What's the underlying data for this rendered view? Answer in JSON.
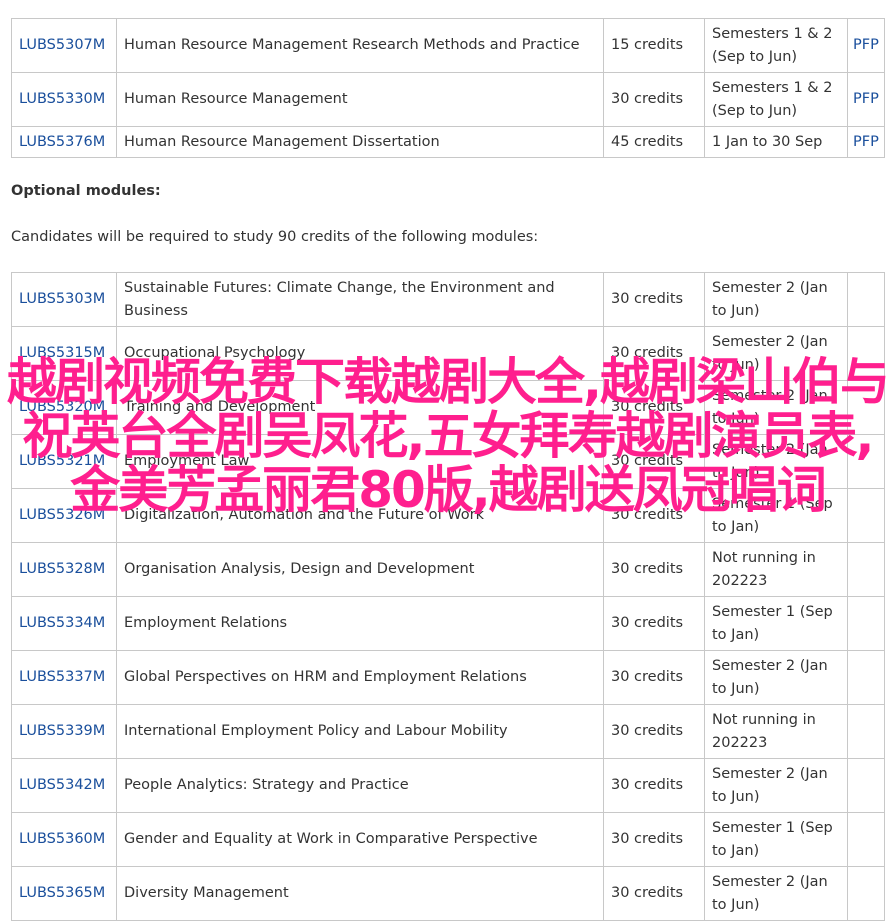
{
  "core_modules": [
    {
      "code": "LUBS5307M",
      "title": "Human Resource Management Research Methods and Practice",
      "credits": "15 credits",
      "semester": "Semesters 1 & 2 (Sep to Jun)",
      "link": "PFP"
    },
    {
      "code": "LUBS5330M",
      "title": "Human Resource Management",
      "credits": "30 credits",
      "semester": "Semesters 1 & 2 (Sep to Jun)",
      "link": "PFP"
    },
    {
      "code": "LUBS5376M",
      "title": "Human Resource Management Dissertation",
      "credits": "45 credits",
      "semester": "1 Jan to 30 Sep",
      "link": "PFP"
    }
  ],
  "optional": {
    "heading": "Optional modules:",
    "intro": "Candidates will be required to study 90 credits of the following modules:"
  },
  "optional_modules": [
    {
      "code": "LUBS5303M",
      "title": "Sustainable Futures: Climate Change, the Environment and Business",
      "credits": "30 credits",
      "semester": "Semester 2 (Jan to Jun)"
    },
    {
      "code": "LUBS5315M",
      "title": "Occupational Psychology",
      "credits": "30 credits",
      "semester": "Semester 2 (Jan to Jun)"
    },
    {
      "code": "LUBS5320M",
      "title": "Training and Development",
      "credits": "30 credits",
      "semester": "Semester 2 (Jan to Jun)"
    },
    {
      "code": "LUBS5321M",
      "title": "Employment Law",
      "credits": "30 credits",
      "semester": "Semester 2 (Jan to Jun)"
    },
    {
      "code": "LUBS5326M",
      "title": "Digitalization, Automation and the Future of Work",
      "credits": "30 credits",
      "semester": "Semester 1 (Sep to Jan)"
    },
    {
      "code": "LUBS5328M",
      "title": "Organisation Analysis, Design and Development",
      "credits": "30 credits",
      "semester": "Not running in 202223"
    },
    {
      "code": "LUBS5334M",
      "title": "Employment Relations",
      "credits": "30 credits",
      "semester": "Semester 1 (Sep to Jan)"
    },
    {
      "code": "LUBS5337M",
      "title": "Global Perspectives on HRM and Employment Relations",
      "credits": "30 credits",
      "semester": "Semester 2 (Jan to Jun)"
    },
    {
      "code": "LUBS5339M",
      "title": "International Employment Policy and Labour Mobility",
      "credits": "30 credits",
      "semester": "Not running in 202223"
    },
    {
      "code": "LUBS5342M",
      "title": "People Analytics: Strategy and Practice",
      "credits": "30 credits",
      "semester": "Semester 2 (Jan to Jun)"
    },
    {
      "code": "LUBS5360M",
      "title": "Gender and Equality at Work in Comparative Perspective",
      "credits": "30 credits",
      "semester": "Semester 1 (Sep to Jan)"
    },
    {
      "code": "LUBS5365M",
      "title": "Diversity Management",
      "credits": "30 credits",
      "semester": "Semester 2 (Jan to Jun)"
    }
  ],
  "overlay_text": "越剧视频免费下载越剧大全,越剧梁山伯与祝英台全剧吴凤花,五女拜寿越剧演员表,金美芳孟丽君80版,越剧送凤冠唱词",
  "colors": {
    "link": "#1a4f9c",
    "overlay": "#ff1f8e",
    "border": "#c8c8c8"
  }
}
